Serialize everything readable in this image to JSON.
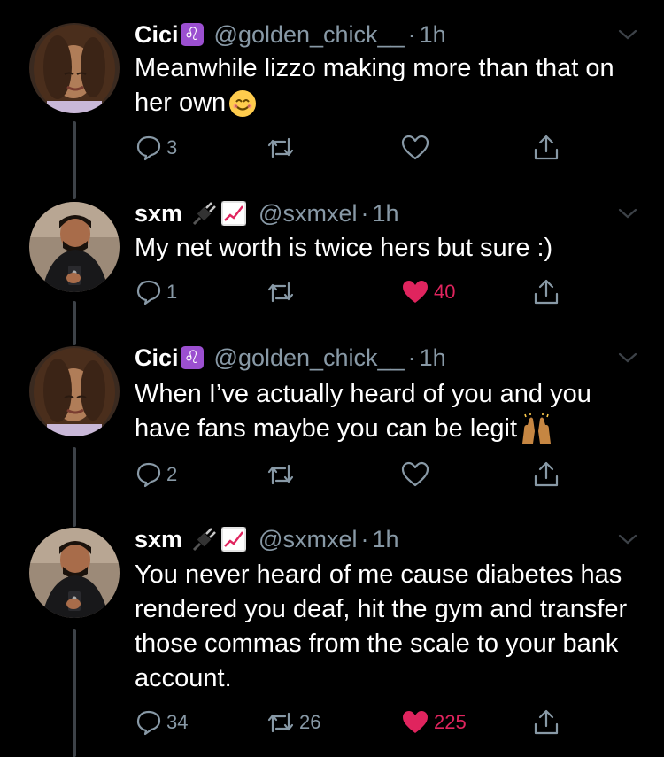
{
  "tweets": [
    {
      "name": "Cici",
      "badge": "♌",
      "handle": "@golden_chick__",
      "time": "1h",
      "text": "Meanwhile lizzo making more than that on her own",
      "emoji": "smiling-face",
      "reply_count": "3",
      "retweet_count": "",
      "like_count": "",
      "liked": false
    },
    {
      "name": "sxm",
      "handle": "@sxmxel",
      "time": "1h",
      "text": "My net worth is twice hers but sure :)",
      "reply_count": "1",
      "retweet_count": "",
      "like_count": "40",
      "liked": true
    },
    {
      "name": "Cici",
      "badge": "♌",
      "handle": "@golden_chick__",
      "time": "1h",
      "text": "When I’ve actually heard of you and you have fans maybe you can be legit",
      "emoji": "raised-hands",
      "reply_count": "2",
      "retweet_count": "",
      "like_count": "",
      "liked": false
    },
    {
      "name": "sxm",
      "handle": "@sxmxel",
      "time": "1h",
      "text": "You never heard of me cause diabetes has rendered you deaf, hit the gym and transfer those commas from the scale to your bank account.",
      "reply_count": "34",
      "retweet_count": "26",
      "like_count": "225",
      "liked": true
    }
  ],
  "dot": "·",
  "colors": {
    "background": "#000000",
    "secondary_text": "#8899a6",
    "like_red": "#e0245e",
    "thread_line": "#3d4248",
    "leo_badge": "#9b4fd0"
  }
}
